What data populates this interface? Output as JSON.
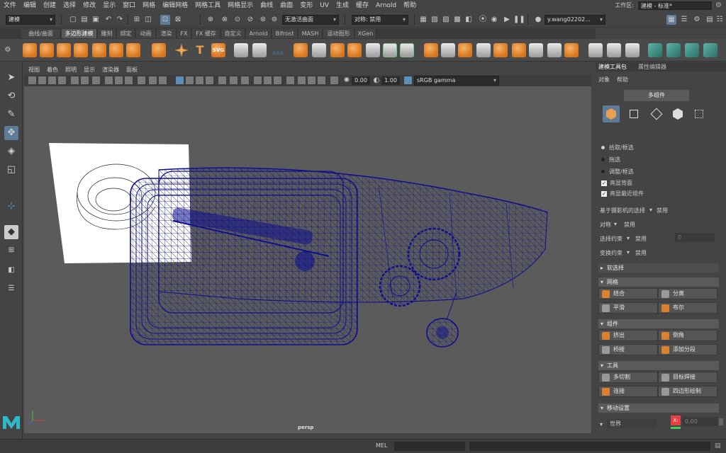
{
  "menubar": {
    "items": [
      "文件",
      "编辑",
      "创建",
      "选择",
      "修改",
      "显示",
      "窗口",
      "网格",
      "编辑网格",
      "网格工具",
      "网格显示",
      "曲线",
      "曲面",
      "变形",
      "UV",
      "生成",
      "缓存",
      "Arnold",
      "帮助"
    ],
    "workspace_label": "工作区:",
    "workspace_value": "建模 - 标准*"
  },
  "statusline": {
    "mode": "建模",
    "live_surface": "无激活曲面",
    "symmetry": "对称: 禁用",
    "user": "y.wang02202..."
  },
  "shelf_tabs": [
    "曲线/曲面",
    "多边形建模",
    "雕刻",
    "绑定",
    "动画",
    "渲染",
    "FX",
    "FX 缓存",
    "自定义",
    "Arnold",
    "Bifrost",
    "MASH",
    "运动图形",
    "XGen"
  ],
  "shelf_active_tab": "多边形建模",
  "shelf_text_icons": {
    "text": "T",
    "svg": "SVG",
    "numbers": "0,0,0"
  },
  "viewport": {
    "menu": [
      "视图",
      "着色",
      "照明",
      "显示",
      "渲染器",
      "面板"
    ],
    "exposure": "0.00",
    "gamma": "1.00",
    "colorspace": "sRGB gamma",
    "camera_label": "persp"
  },
  "right_panel": {
    "tabs": [
      "建模工具包",
      "属性编辑器"
    ],
    "links": [
      "对象",
      "帮助"
    ],
    "multi_component": "多组件",
    "pick_options": [
      "拾取/框选",
      "拖选",
      "调整/框选"
    ],
    "checks": [
      "亮显背面",
      "亮显最近组件"
    ],
    "camera_selection": "基于摄影机的选择",
    "camera_selection_value": "禁用",
    "symmetry": "对称",
    "symmetry_value": "禁用",
    "select_constraint": "选择约束",
    "select_constraint_value": "禁用",
    "select_constraint_num": "0",
    "transform_constraint": "变换约束",
    "transform_constraint_value": "禁用",
    "soft_select": "软选择",
    "mesh_header": "网格",
    "mesh_buttons": [
      "结合",
      "分离",
      "平滑",
      "布尔"
    ],
    "component_header": "组件",
    "component_buttons": [
      "挤出",
      "倒角",
      "桥接",
      "添加分段"
    ],
    "tools_header": "工具",
    "tools_buttons": [
      "多切割",
      "目标焊接",
      "连接",
      "四边形绘制"
    ],
    "move_header": "移动设置",
    "world_label": "世界",
    "x_label": "X:",
    "x_value": "0.00"
  },
  "cmdline": {
    "mel_label": "MEL"
  },
  "colors": {
    "accent": "#5e7c98",
    "wire": "#0f0f8c",
    "maya_logo": "#2fb8c7"
  }
}
